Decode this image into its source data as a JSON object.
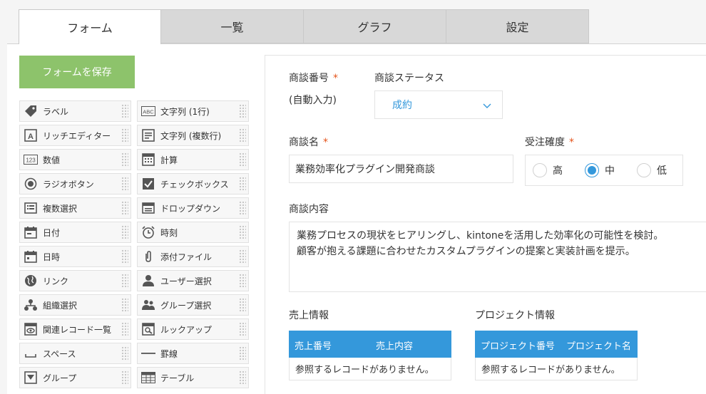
{
  "tabs": [
    "フォーム",
    "一覧",
    "グラフ",
    "設定"
  ],
  "save_button": "フォームを保存",
  "palette": {
    "left": [
      {
        "label": "ラベル",
        "icon": "tag-icon"
      },
      {
        "label": "リッチエディター",
        "icon": "rich-editor-icon"
      },
      {
        "label": "数値",
        "icon": "number-icon"
      },
      {
        "label": "ラジオボタン",
        "icon": "radio-button-icon"
      },
      {
        "label": "複数選択",
        "icon": "multi-select-icon"
      },
      {
        "label": "日付",
        "icon": "date-icon"
      },
      {
        "label": "日時",
        "icon": "datetime-icon"
      },
      {
        "label": "リンク",
        "icon": "globe-icon"
      },
      {
        "label": "組織選択",
        "icon": "org-icon"
      },
      {
        "label": "関連レコード一覧",
        "icon": "related-records-icon"
      },
      {
        "label": "スペース",
        "icon": "space-icon"
      },
      {
        "label": "グループ",
        "icon": "group-icon"
      }
    ],
    "right": [
      {
        "label": "文字列 (1行)",
        "icon": "text-single-icon",
        "icon_text": "ABC"
      },
      {
        "label": "文字列 (複数行)",
        "icon": "text-multi-icon"
      },
      {
        "label": "計算",
        "icon": "calculator-icon"
      },
      {
        "label": "チェックボックス",
        "icon": "checkbox-icon"
      },
      {
        "label": "ドロップダウン",
        "icon": "dropdown-icon"
      },
      {
        "label": "時刻",
        "icon": "clock-icon"
      },
      {
        "label": "添付ファイル",
        "icon": "paperclip-icon"
      },
      {
        "label": "ユーザー選択",
        "icon": "user-icon"
      },
      {
        "label": "グループ選択",
        "icon": "users-icon"
      },
      {
        "label": "ルックアップ",
        "icon": "lookup-icon"
      },
      {
        "label": "罫線",
        "icon": "line-icon"
      },
      {
        "label": "テーブル",
        "icon": "table-icon"
      }
    ],
    "number_icon_text": "123"
  },
  "form": {
    "deal_number": {
      "label": "商談番号",
      "required_mark": "*",
      "value": "(自動入力)"
    },
    "deal_status": {
      "label": "商談ステータス",
      "value": "成約"
    },
    "deal_name": {
      "label": "商談名",
      "required_mark": "*",
      "value": "業務効率化プラグイン開発商談"
    },
    "probability": {
      "label": "受注確度",
      "required_mark": "*",
      "options": [
        "高",
        "中",
        "低"
      ],
      "selected": "中"
    },
    "deal_content": {
      "label": "商談内容",
      "line1": "業務プロセスの現状をヒアリングし、kintoneを活用した効率化の可能性を検討。",
      "line2": "顧客が抱える課題に合わせたカスタムプラグインの提案と実装計画を提示。"
    },
    "sales_info": {
      "label": "売上情報",
      "columns": [
        "売上番号",
        "売上内容"
      ],
      "empty": "参照するレコードがありません。"
    },
    "project_info": {
      "label": "プロジェクト情報",
      "columns": [
        "プロジェクト番号",
        "プロジェクト名"
      ],
      "empty": "参照するレコードがありません。"
    }
  },
  "colors": {
    "accent": "#3498db",
    "save": "#8dc36b",
    "required": "#e5541b"
  }
}
